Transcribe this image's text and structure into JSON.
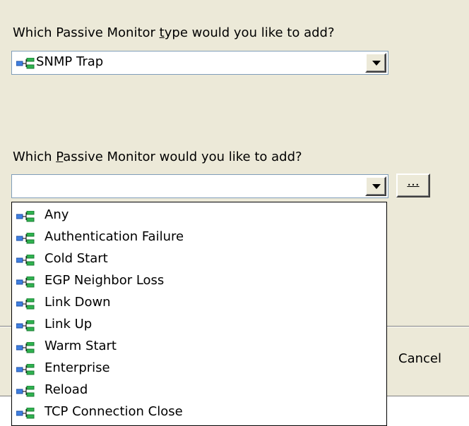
{
  "monitor_type_prompt": {
    "before": "Which Passive Monitor ",
    "underlined": "t",
    "after": "ype would you like to add?"
  },
  "monitor_type_combo": {
    "selected": "SNMP Trap",
    "icon": "network-tree-icon"
  },
  "monitor_prompt": {
    "before": "Which ",
    "underlined": "P",
    "after": "assive Monitor would you like to add?"
  },
  "monitor_combo": {
    "selected": ""
  },
  "browse_button": {
    "label": "..."
  },
  "dropdown": {
    "items": [
      {
        "label": "Any",
        "icon": "network-tree-icon"
      },
      {
        "label": "Authentication Failure",
        "icon": "network-tree-icon"
      },
      {
        "label": "Cold Start",
        "icon": "network-tree-icon"
      },
      {
        "label": "EGP Neighbor Loss",
        "icon": "network-tree-icon"
      },
      {
        "label": "Link Down",
        "icon": "network-tree-icon"
      },
      {
        "label": "Link Up",
        "icon": "network-tree-icon"
      },
      {
        "label": "Warm Start",
        "icon": "network-tree-icon"
      },
      {
        "label": "Enterprise",
        "icon": "network-tree-icon"
      },
      {
        "label": "Reload",
        "icon": "network-tree-icon"
      },
      {
        "label": "TCP Connection Close",
        "icon": "network-tree-icon"
      }
    ]
  },
  "footer": {
    "cancel_label": "Cancel"
  }
}
